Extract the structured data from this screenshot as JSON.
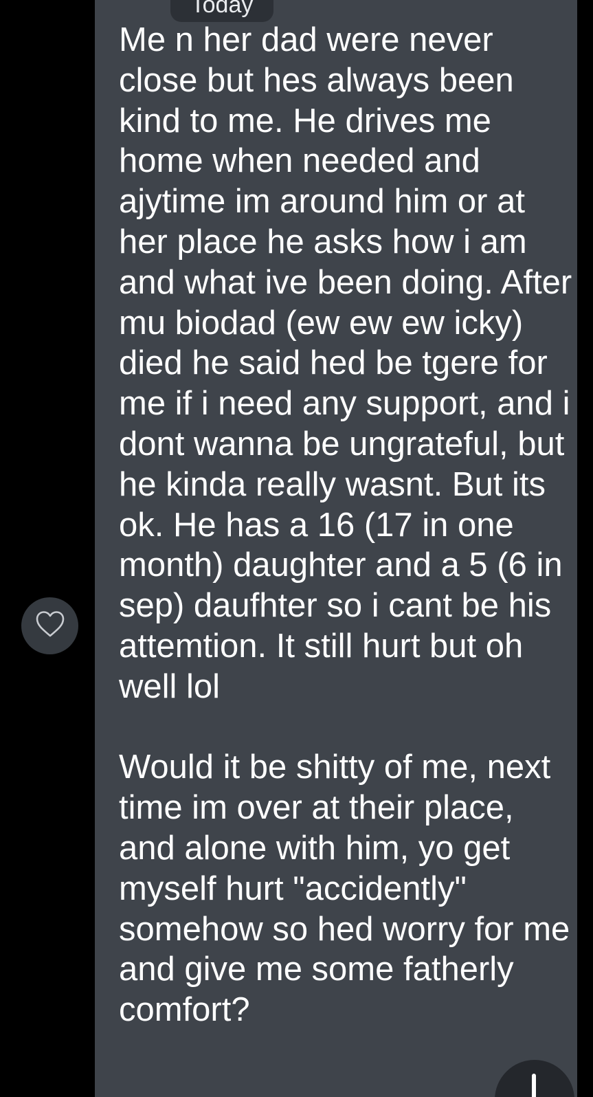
{
  "chat": {
    "date_label": "Today",
    "message": {
      "text": "Me n her dad were never close but hes always been kind to me. He drives me home when needed and ajytime im around him or at her place he asks how i am and what ive been doing. After mu biodad (ew ew ew icky) died he said hed be tgere for me if i need any support, and i dont wanna be ungrateful, but he kinda really wasnt. But its ok. He has a 16 (17 in one month) daughter and a 5 (6 in sep) daufhter so i cant be his attemtion. It still hurt but oh well lol\n\nWould it be shitty of me, next time im over at their place, and alone with him, yo get myself hurt \"accidently\" somehow so hed worry for me and give me some fatherly comfort?"
    }
  },
  "icons": {
    "react": "heart-outline-icon",
    "scroll": "arrow-down-icon"
  },
  "colors": {
    "background": "#000000",
    "bubble": "#3f444b",
    "text": "#ffffff",
    "date_chip": "#2c3036",
    "react_button": "#353a40",
    "scroll_button": "#24272c"
  }
}
